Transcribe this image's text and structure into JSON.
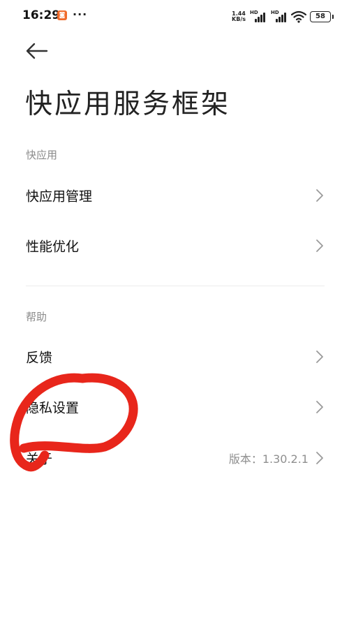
{
  "status_bar": {
    "time": "16:29",
    "app_icon": "notification-app-icon",
    "more": "···",
    "net_speed_value": "1.44",
    "net_speed_unit": "KB/s",
    "signal1_label": "HD",
    "signal2_label": "HD",
    "battery": "58"
  },
  "header": {
    "back_icon": "arrow-left-icon",
    "title": "快应用服务框架"
  },
  "sections": {
    "quick_app": {
      "label": "快应用",
      "items": [
        {
          "label": "快应用管理"
        },
        {
          "label": "性能优化"
        }
      ]
    },
    "help": {
      "label": "帮助",
      "items": [
        {
          "label": "反馈"
        },
        {
          "label": "隐私设置"
        },
        {
          "label": "关于",
          "value": "版本：1.30.2.1"
        }
      ]
    }
  },
  "colors": {
    "annotation": "#e8261b",
    "secondary_text": "#8a8a8a"
  }
}
